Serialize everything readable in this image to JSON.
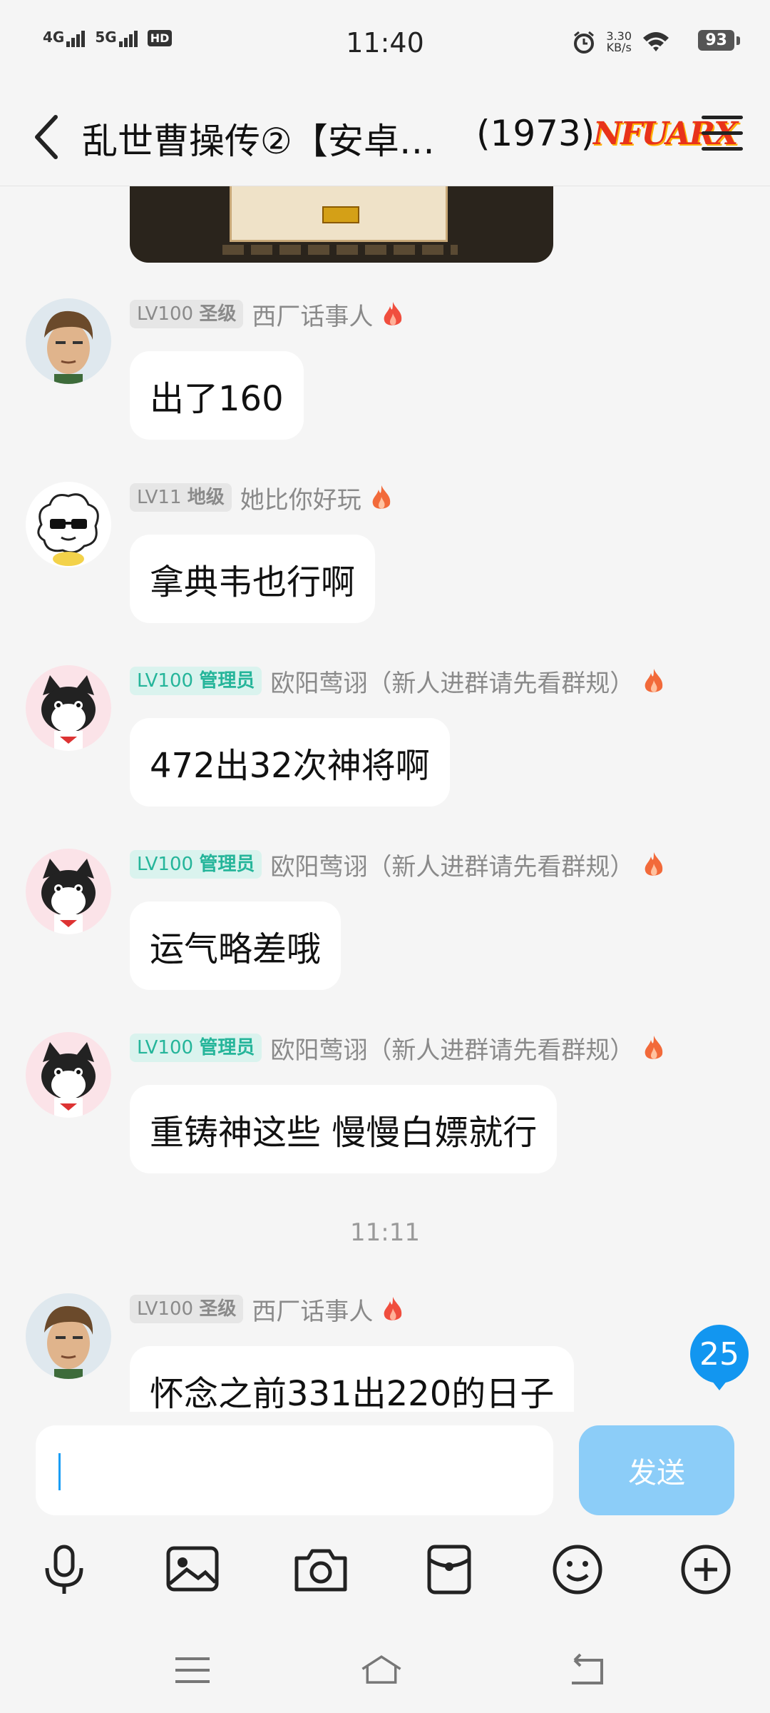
{
  "status_bar": {
    "network1": "4G",
    "network2": "5G",
    "hd_label": "HD",
    "time": "11:40",
    "speed_value": "3.30",
    "speed_unit": "KB/s",
    "battery": "93"
  },
  "header": {
    "title": "乱世曹操传②【安卓…",
    "member_count": "(1973)",
    "logo_text": "NFUARX"
  },
  "messages": [
    {
      "level": "LV100",
      "role": "圣级",
      "nickname": "西厂话事人",
      "text": "出了160"
    },
    {
      "level": "LV11",
      "role": "地级",
      "nickname": "她比你好玩",
      "text": "拿典韦也行啊"
    },
    {
      "level": "LV100",
      "role": "管理员",
      "nickname": "欧阳莺诩（新人进群请先看群规）",
      "text": "472出32次神将啊"
    },
    {
      "level": "LV100",
      "role": "管理员",
      "nickname": "欧阳莺诩（新人进群请先看群规）",
      "text": "运气略差哦"
    },
    {
      "level": "LV100",
      "role": "管理员",
      "nickname": "欧阳莺诩（新人进群请先看群规）",
      "text": "重铸神这些 慢慢白嫖就行"
    },
    {
      "level": "LV100",
      "role": "圣级",
      "nickname": "西厂话事人",
      "text": "怀念之前331出220的日子"
    }
  ],
  "timestamp": "11:11",
  "unread_count": "25",
  "composer": {
    "send_label": "发送",
    "input_value": ""
  },
  "colors": {
    "accent": "#1296f0",
    "send_disabled": "#8ccdf8",
    "admin_badge": "#25b59a"
  },
  "toolbar_icons": [
    "microphone-icon",
    "image-icon",
    "camera-icon",
    "red-packet-icon",
    "emoji-icon",
    "plus-icon"
  ],
  "nav_icons": [
    "menu-icon",
    "home-icon",
    "back-icon"
  ]
}
